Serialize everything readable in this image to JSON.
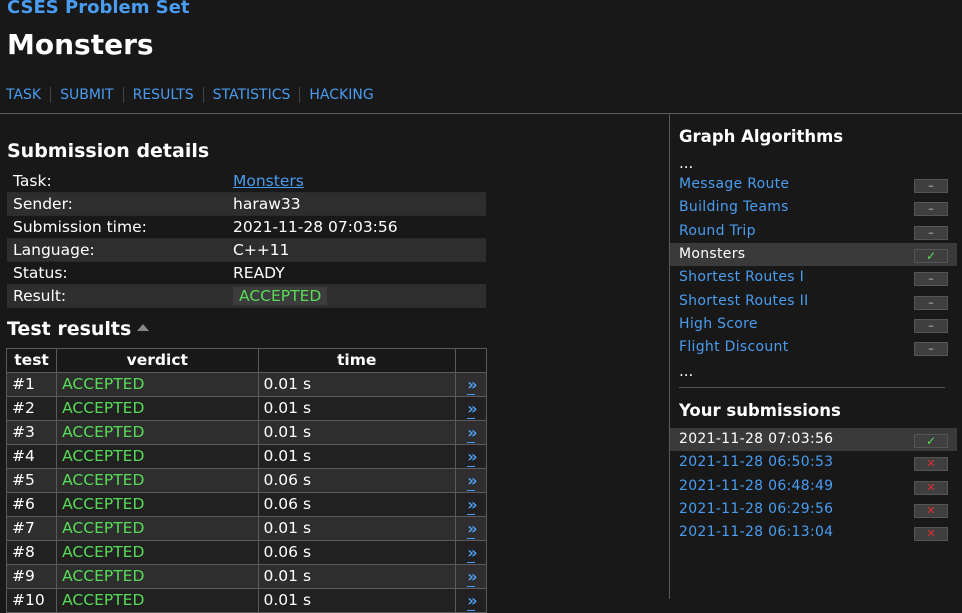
{
  "site_title": "CSES Problem Set",
  "page_title": "Monsters",
  "nav": [
    "TASK",
    "SUBMIT",
    "RESULTS",
    "STATISTICS",
    "HACKING"
  ],
  "details": {
    "heading": "Submission details",
    "rows": [
      {
        "key": "Task:",
        "value": "Monsters"
      },
      {
        "key": "Sender:",
        "value": "haraw33"
      },
      {
        "key": "Submission time:",
        "value": "2021-11-28 07:03:56"
      },
      {
        "key": "Language:",
        "value": "C++11"
      },
      {
        "key": "Status:",
        "value": "READY"
      },
      {
        "key": "Result:",
        "value": "ACCEPTED"
      }
    ]
  },
  "tests": {
    "heading": "Test results",
    "columns": [
      "test",
      "verdict",
      "time",
      ""
    ],
    "rows": [
      {
        "test": "#1",
        "verdict": "ACCEPTED",
        "time": "0.01 s",
        "link": "»"
      },
      {
        "test": "#2",
        "verdict": "ACCEPTED",
        "time": "0.01 s",
        "link": "»"
      },
      {
        "test": "#3",
        "verdict": "ACCEPTED",
        "time": "0.01 s",
        "link": "»"
      },
      {
        "test": "#4",
        "verdict": "ACCEPTED",
        "time": "0.01 s",
        "link": "»"
      },
      {
        "test": "#5",
        "verdict": "ACCEPTED",
        "time": "0.06 s",
        "link": "»"
      },
      {
        "test": "#6",
        "verdict": "ACCEPTED",
        "time": "0.06 s",
        "link": "»"
      },
      {
        "test": "#7",
        "verdict": "ACCEPTED",
        "time": "0.01 s",
        "link": "»"
      },
      {
        "test": "#8",
        "verdict": "ACCEPTED",
        "time": "0.06 s",
        "link": "»"
      },
      {
        "test": "#9",
        "verdict": "ACCEPTED",
        "time": "0.01 s",
        "link": "»"
      },
      {
        "test": "#10",
        "verdict": "ACCEPTED",
        "time": "0.01 s",
        "link": "»"
      }
    ]
  },
  "sidebar": {
    "heading": "Graph Algorithms",
    "ellipsis_top": "...",
    "ellipsis_bottom": "...",
    "problems": [
      {
        "label": "Message Route",
        "mark": "–",
        "state": "none"
      },
      {
        "label": "Building Teams",
        "mark": "–",
        "state": "none"
      },
      {
        "label": "Round Trip",
        "mark": "–",
        "state": "none"
      },
      {
        "label": "Monsters",
        "mark": "✓",
        "state": "ok"
      },
      {
        "label": "Shortest Routes I",
        "mark": "–",
        "state": "none"
      },
      {
        "label": "Shortest Routes II",
        "mark": "–",
        "state": "none"
      },
      {
        "label": "High Score",
        "mark": "–",
        "state": "none"
      },
      {
        "label": "Flight Discount",
        "mark": "–",
        "state": "none"
      }
    ],
    "submissions_heading": "Your submissions",
    "submissions": [
      {
        "label": "2021-11-28 07:03:56",
        "mark": "✓",
        "state": "ok"
      },
      {
        "label": "2021-11-28 06:50:53",
        "mark": "✕",
        "state": "fail"
      },
      {
        "label": "2021-11-28 06:48:49",
        "mark": "✕",
        "state": "fail"
      },
      {
        "label": "2021-11-28 06:29:56",
        "mark": "✕",
        "state": "fail"
      },
      {
        "label": "2021-11-28 06:13:04",
        "mark": "✕",
        "state": "fail"
      }
    ]
  },
  "colors": {
    "link": "#4a9cf0",
    "accepted": "#58dc58",
    "fail": "#e03030",
    "background": "#181818"
  }
}
